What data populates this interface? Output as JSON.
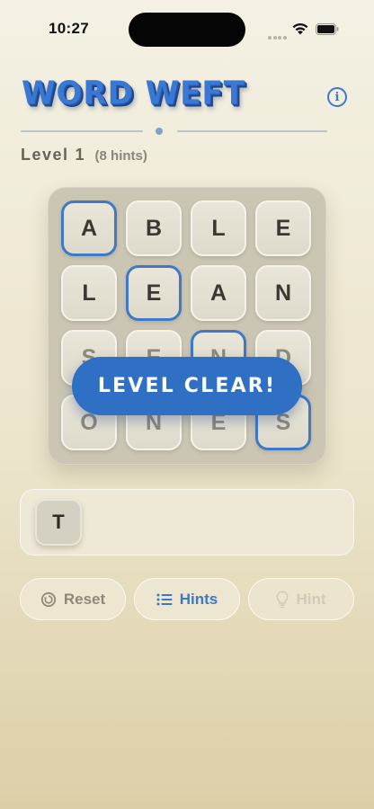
{
  "status_bar": {
    "time": "10:27"
  },
  "header": {
    "title": "WORD WEFT",
    "info_icon": "i"
  },
  "level": {
    "label": "Level",
    "number": "1",
    "hints_text": "(8 hints)"
  },
  "board": {
    "rows": [
      [
        "A",
        "B",
        "L",
        "E"
      ],
      [
        "L",
        "E",
        "A",
        "N"
      ],
      [
        "S",
        "E",
        "N",
        "D"
      ],
      [
        "O",
        "N",
        "E",
        "S"
      ]
    ],
    "selected": [
      [
        0,
        0
      ],
      [
        1,
        1
      ],
      [
        2,
        2
      ],
      [
        3,
        3
      ]
    ]
  },
  "banner": {
    "text": "LEVEL CLEAR!"
  },
  "tray": {
    "letters": [
      "T"
    ]
  },
  "buttons": {
    "reset": "Reset",
    "hints": "Hints",
    "hint": "Hint"
  },
  "colors": {
    "accent": "#3a78d4",
    "banner": "#2f6fc4",
    "background": "#f0ebd8"
  }
}
